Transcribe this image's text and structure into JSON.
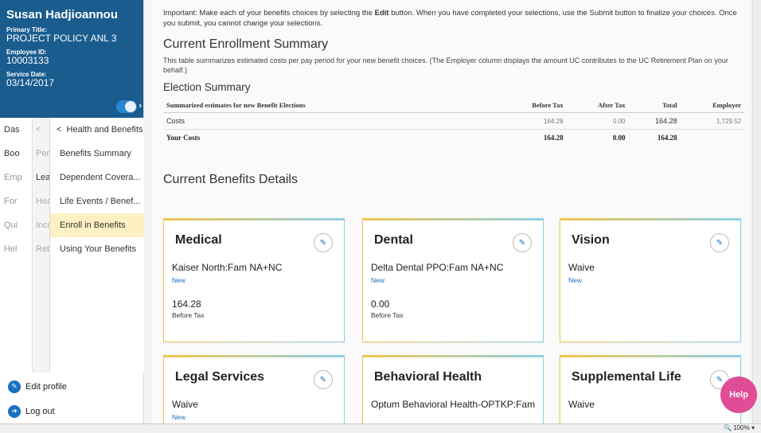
{
  "profile": {
    "name": "Susan Hadjioannou",
    "primary_title_label": "Primary Title:",
    "primary_title": "PROJECT POLICY ANL 3",
    "employee_id_label": "Employee ID:",
    "employee_id": "10003133",
    "service_date_label": "Service Date:",
    "service_date": "03/14/2017"
  },
  "nav": {
    "col1": [
      "Das",
      "Boo",
      "Emp",
      "For",
      "Qui",
      "Hel"
    ],
    "col2": [
      "<",
      "Pers",
      "Leav",
      "Hea",
      "Inco",
      "Reti"
    ],
    "col3_header": "Health and Benefits",
    "col3": [
      "Benefits Summary",
      "Dependent Covera...",
      "Life Events / Benef...",
      "Enroll in Benefits",
      "Using Your Benefits"
    ]
  },
  "bottom_links": {
    "edit_profile": "Edit profile",
    "log_out": "Log out"
  },
  "main": {
    "notice_pre": "Important: Make each of your benefits choices by selecting the ",
    "notice_bold": "Edit",
    "notice_post": " button. When you have completed your selections, use the Submit button to finalize your choices. Once you submit, you cannot change your selections.",
    "enrollment_title": "Current Enrollment Summary",
    "enrollment_desc": "This table summarizes estimated costs per pay period for your new benefit choices. (The Employer column displays the amount UC contributes to the UC Retirement Plan on your behalf.)",
    "election_title": "Election Summary",
    "table": {
      "headers": [
        "Summarized estimates for new Benefit Elections",
        "Before Tax",
        "After Tax",
        "Total",
        "Employer"
      ],
      "rows": [
        [
          "Costs",
          "164.28",
          "0.00",
          "164.28",
          "1,729.52"
        ],
        [
          "Your Costs",
          "164.28",
          "0.00",
          "164.28",
          ""
        ]
      ]
    },
    "details_title": "Current Benefits Details"
  },
  "cards": [
    {
      "title": "Medical",
      "plan": "Kaiser North:Fam NA+NC",
      "new": "New",
      "amount": "164.28",
      "tax": "Before Tax"
    },
    {
      "title": "Dental",
      "plan": "Delta Dental PPO:Fam NA+NC",
      "new": "New",
      "amount": "0.00",
      "tax": "Before Tax"
    },
    {
      "title": "Vision",
      "plan": "Waive",
      "new": "New",
      "amount": "",
      "tax": ""
    },
    {
      "title": "Legal Services",
      "plan": "Waive",
      "new": "New",
      "amount": "",
      "tax": ""
    },
    {
      "title": "Behavioral Health",
      "plan": "Optum Behavioral Health-OPTKP:Fam",
      "new": "",
      "amount": "",
      "tax": ""
    },
    {
      "title": "Supplemental Life",
      "plan": "Waive",
      "new": "",
      "amount": "",
      "tax": ""
    }
  ],
  "help_label": "Help",
  "zoom": "100%",
  "colors": {
    "brand": "#1a5c8e",
    "accent": "#1a70c2",
    "help": "#e04d96"
  }
}
